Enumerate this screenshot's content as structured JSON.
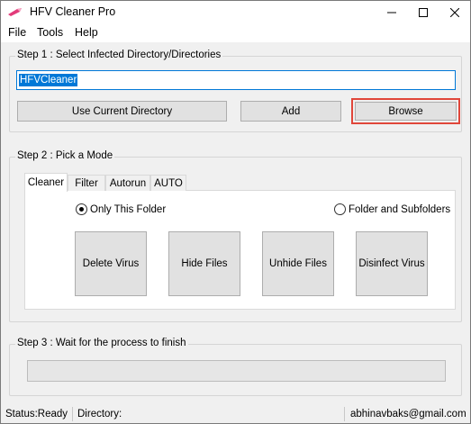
{
  "window": {
    "title": "HFV Cleaner Pro"
  },
  "icons": {
    "app": "lipstick-icon",
    "minimize": "minimize-icon",
    "maximize": "maximize-icon",
    "close": "close-icon"
  },
  "menu": {
    "file": "File",
    "tools": "Tools",
    "help": "Help"
  },
  "step1": {
    "legend": "Step 1 : Select Infected Directory/Directories",
    "directory_value": "HFVCleaner",
    "use_current_label": "Use Current Directory",
    "add_label": "Add",
    "browse_label": "Browse"
  },
  "step2": {
    "legend": "Step 2 : Pick a Mode",
    "tabs": [
      {
        "label": "Cleaner",
        "active": true
      },
      {
        "label": "Filter",
        "active": false
      },
      {
        "label": "Autorun",
        "active": false
      },
      {
        "label": "AUTO",
        "active": false
      }
    ],
    "scope": {
      "only_this_folder": "Only This Folder",
      "folder_and_subfolders": "Folder and Subfolders",
      "selected": "only_this_folder"
    },
    "actions": {
      "delete_virus": "Delete Virus",
      "hide_files": "Hide Files",
      "unhide_files": "Unhide Files",
      "disinfect_virus": "Disinfect Virus"
    }
  },
  "step3": {
    "legend": "Step 3 : Wait for the process to finish",
    "progress": 0
  },
  "status": {
    "status_text": "Status:Ready",
    "directory_text": "Directory:",
    "email": "abhinavbaks@gmail.com"
  },
  "colors": {
    "highlight_border": "#e0463a",
    "selection": "#0078d7"
  }
}
